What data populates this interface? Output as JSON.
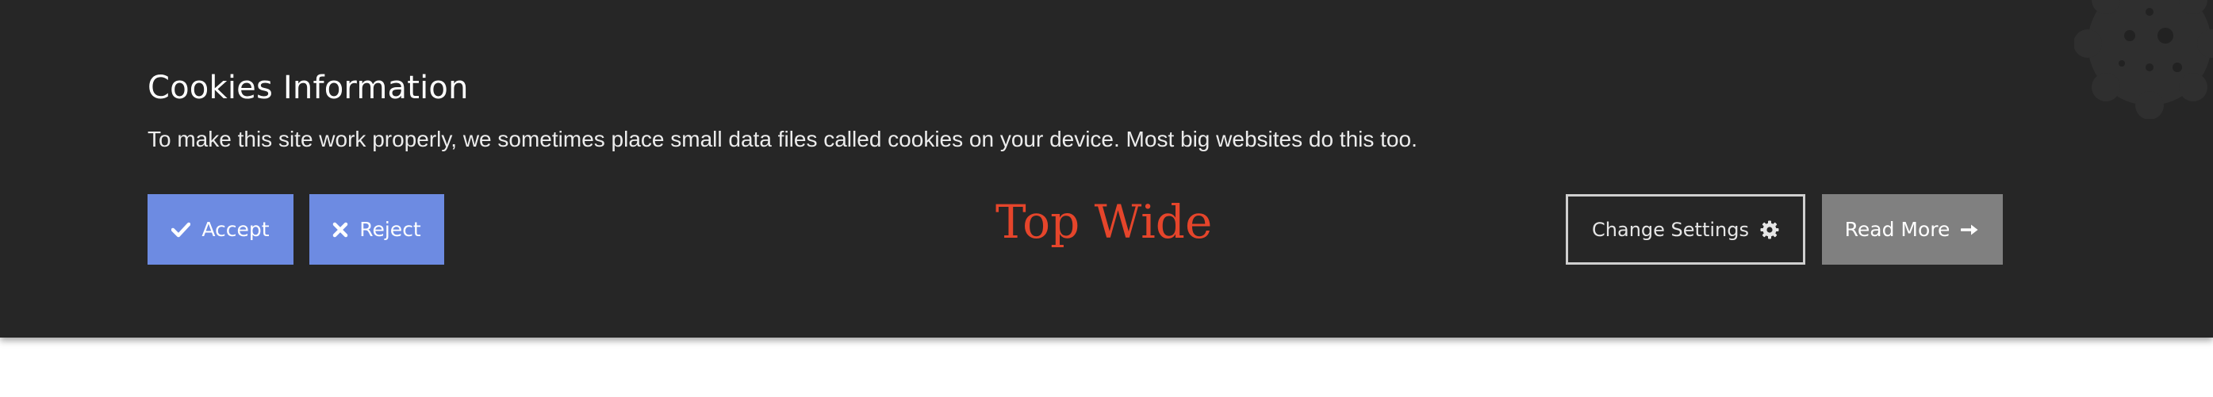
{
  "banner": {
    "title": "Cookies Information",
    "message": "To make this site work properly, we sometimes place small data files called cookies on your device. Most big websites do this too.",
    "center_label": "Top Wide",
    "decoration_icon": "cookie-icon"
  },
  "buttons": {
    "accept": {
      "label": "Accept",
      "icon": "check-icon"
    },
    "reject": {
      "label": "Reject",
      "icon": "close-icon"
    },
    "change_settings": {
      "label": "Change Settings",
      "icon": "gear-icon"
    },
    "read_more": {
      "label": "Read More",
      "icon": "arrow-right-icon"
    }
  },
  "colors": {
    "banner_background": "#262626",
    "primary_button": "#6d8be2",
    "secondary_button": "#808080",
    "center_label": "#e5452b",
    "page_background": "#ffffff"
  }
}
